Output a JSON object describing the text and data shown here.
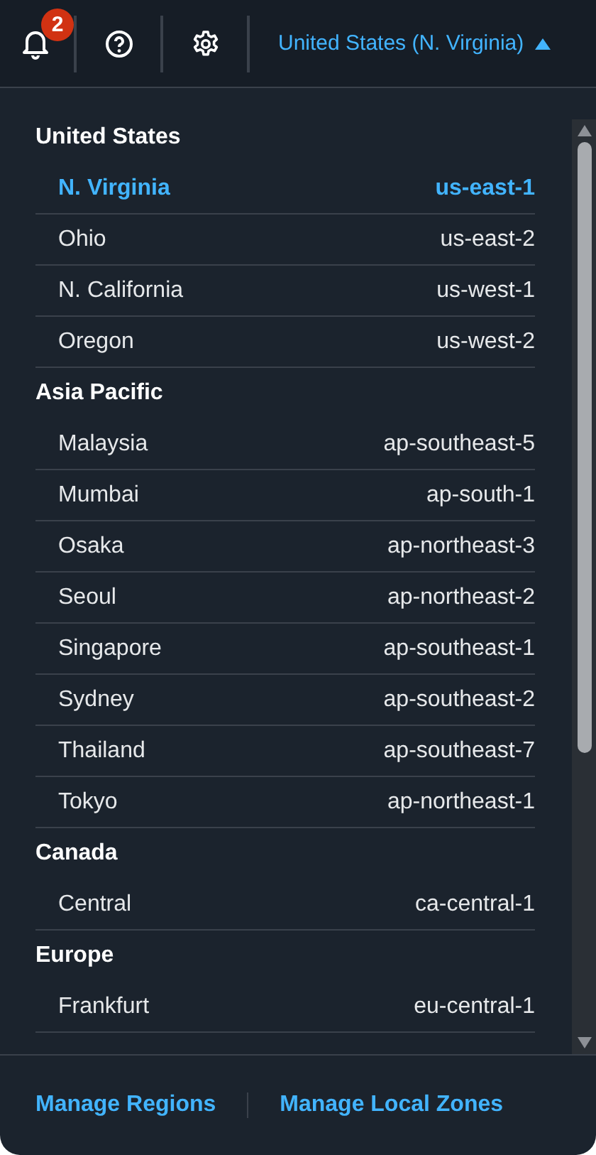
{
  "top_bar": {
    "notification_count": "2",
    "region_selector": {
      "label": "United States (N. Virginia)",
      "expanded": true
    }
  },
  "region_groups": [
    {
      "name": "United States",
      "regions": [
        {
          "name": "N. Virginia",
          "code": "us-east-1",
          "selected": true
        },
        {
          "name": "Ohio",
          "code": "us-east-2",
          "selected": false
        },
        {
          "name": "N. California",
          "code": "us-west-1",
          "selected": false
        },
        {
          "name": "Oregon",
          "code": "us-west-2",
          "selected": false
        }
      ]
    },
    {
      "name": "Asia Pacific",
      "regions": [
        {
          "name": "Malaysia",
          "code": "ap-southeast-5",
          "selected": false
        },
        {
          "name": "Mumbai",
          "code": "ap-south-1",
          "selected": false
        },
        {
          "name": "Osaka",
          "code": "ap-northeast-3",
          "selected": false
        },
        {
          "name": "Seoul",
          "code": "ap-northeast-2",
          "selected": false
        },
        {
          "name": "Singapore",
          "code": "ap-southeast-1",
          "selected": false
        },
        {
          "name": "Sydney",
          "code": "ap-southeast-2",
          "selected": false
        },
        {
          "name": "Thailand",
          "code": "ap-southeast-7",
          "selected": false
        },
        {
          "name": "Tokyo",
          "code": "ap-northeast-1",
          "selected": false
        }
      ]
    },
    {
      "name": "Canada",
      "regions": [
        {
          "name": "Central",
          "code": "ca-central-1",
          "selected": false
        }
      ]
    },
    {
      "name": "Europe",
      "regions": [
        {
          "name": "Frankfurt",
          "code": "eu-central-1",
          "selected": false
        }
      ]
    }
  ],
  "footer_links": [
    "Manage Regions",
    "Manage Local Zones"
  ]
}
